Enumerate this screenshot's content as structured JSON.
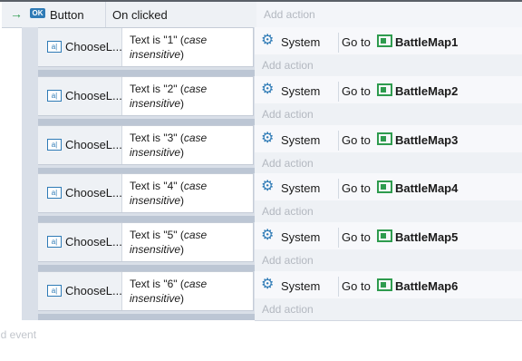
{
  "root_event": {
    "object": "Button",
    "object_icon": "OK",
    "trigger": "On clicked",
    "add_action": "Add action"
  },
  "sub_events": [
    {
      "object": "ChooseL...",
      "cond_prefix": "Text is \"1\" (",
      "cond_italic": "case insensitive",
      "cond_suffix": ")",
      "action_object": "System",
      "action_verb": "Go to",
      "action_target": "BattleMap1",
      "add_action": "Add action"
    },
    {
      "object": "ChooseL...",
      "cond_prefix": "Text is \"2\" (",
      "cond_italic": "case insensitive",
      "cond_suffix": ")",
      "action_object": "System",
      "action_verb": "Go to",
      "action_target": "BattleMap2",
      "add_action": "Add action"
    },
    {
      "object": "ChooseL...",
      "cond_prefix": "Text is \"3\" (",
      "cond_italic": "case insensitive",
      "cond_suffix": ")",
      "action_object": "System",
      "action_verb": "Go to",
      "action_target": "BattleMap3",
      "add_action": "Add action"
    },
    {
      "object": "ChooseL...",
      "cond_prefix": "Text is \"4\" (",
      "cond_italic": "case insensitive",
      "cond_suffix": ")",
      "action_object": "System",
      "action_verb": "Go to",
      "action_target": "BattleMap4",
      "add_action": "Add action"
    },
    {
      "object": "ChooseL...",
      "cond_prefix": "Text is \"5\" (",
      "cond_italic": "case insensitive",
      "cond_suffix": ")",
      "action_object": "System",
      "action_verb": "Go to",
      "action_target": "BattleMap5",
      "add_action": "Add action"
    },
    {
      "object": "ChooseL...",
      "cond_prefix": "Text is \"6\" (",
      "cond_italic": "case insensitive",
      "cond_suffix": ")",
      "action_object": "System",
      "action_verb": "Go to",
      "action_target": "BattleMap6",
      "add_action": "Add action"
    }
  ],
  "add_event": "dd event",
  "icons": {
    "arrow": "arrow-right-icon",
    "button_object": "ok-button-icon",
    "textbox_object": "textbox-icon",
    "system": "gear-icon",
    "layout": "layout-icon"
  },
  "colors": {
    "accent_blue": "#2f7bb6",
    "accent_green": "#2e9b4e"
  }
}
